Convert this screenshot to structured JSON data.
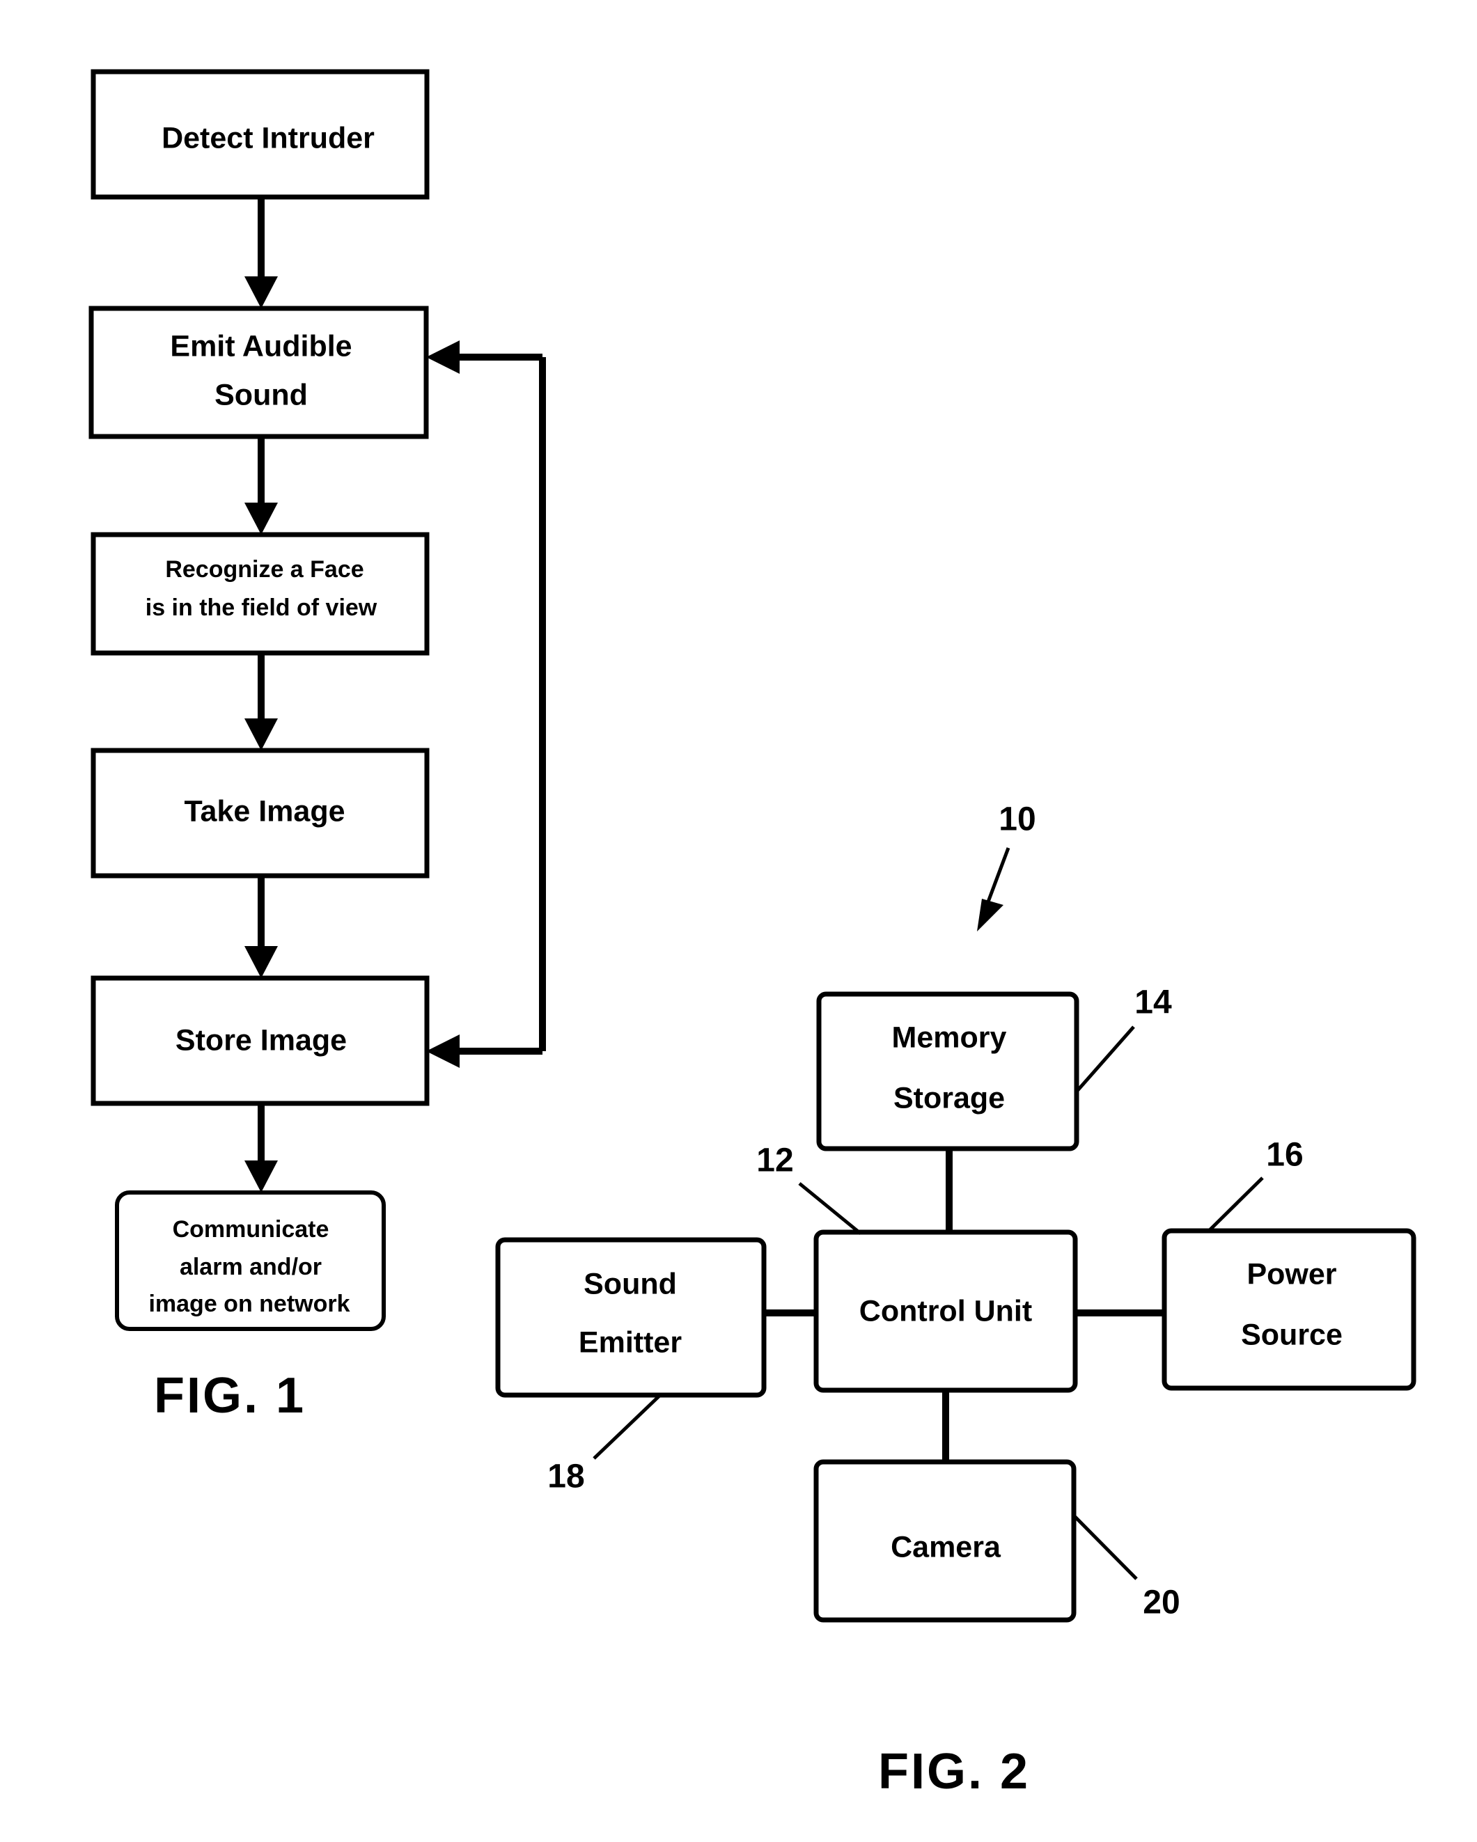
{
  "figure1": {
    "label": "FIG. 1",
    "steps": [
      {
        "id": "detect-intruder",
        "text": [
          "Detect Intruder"
        ]
      },
      {
        "id": "emit-audible-sound",
        "text": [
          "Emit Audible",
          "Sound"
        ]
      },
      {
        "id": "recognize-face",
        "text": [
          "Recognize a Face",
          "is in the field of view"
        ]
      },
      {
        "id": "take-image",
        "text": [
          "Take Image"
        ]
      },
      {
        "id": "store-image",
        "text": [
          "Store Image"
        ]
      },
      {
        "id": "communicate-alarm",
        "text": [
          "Communicate",
          "alarm and/or",
          "image on network"
        ]
      }
    ],
    "feedback_note": "loop from Store Image back to Emit Audible Sound"
  },
  "figure2": {
    "label": "FIG. 2",
    "system_ref": "10",
    "blocks": [
      {
        "id": "memory-storage",
        "text": [
          "Memory",
          "Storage"
        ],
        "ref": "14"
      },
      {
        "id": "control-unit",
        "text": [
          "Control Unit"
        ],
        "ref": "12"
      },
      {
        "id": "sound-emitter",
        "text": [
          "Sound",
          "Emitter"
        ],
        "ref": "18"
      },
      {
        "id": "power-source",
        "text": [
          "Power",
          "Source"
        ],
        "ref": "16"
      },
      {
        "id": "camera",
        "text": [
          "Camera"
        ],
        "ref": "20"
      }
    ]
  },
  "colors": {
    "ink": "#000000",
    "paper": "#ffffff"
  }
}
